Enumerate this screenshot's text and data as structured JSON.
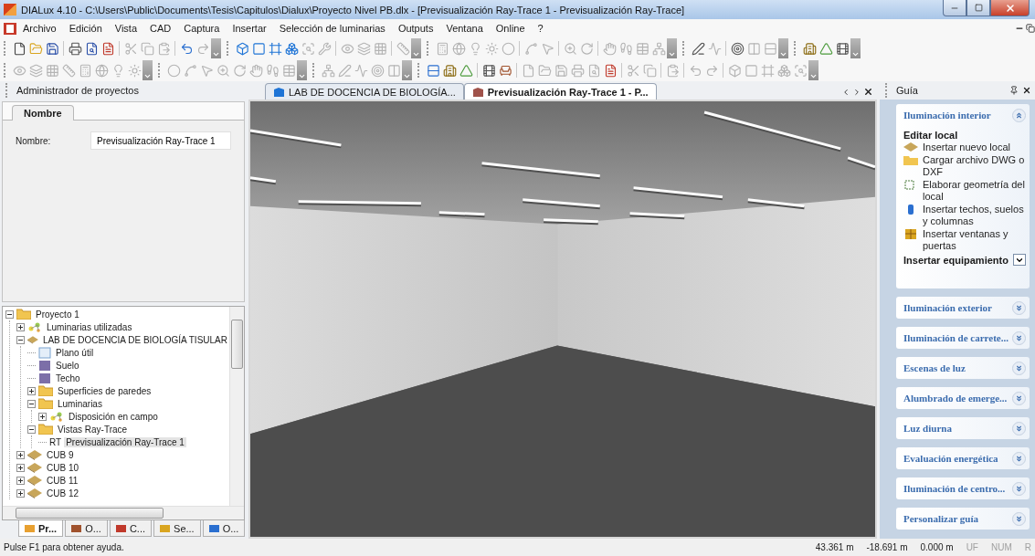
{
  "window": {
    "title": "DIALux 4.10 - C:\\Users\\Public\\Documents\\Tesis\\Capitulos\\Dialux\\Proyecto Nivel PB.dlx - [Previsualización Ray-Trace 1 - Previsualización Ray-Trace]"
  },
  "menu": [
    "Archivo",
    "Edición",
    "Vista",
    "CAD",
    "Captura",
    "Insertar",
    "Selección de luminarias",
    "Outputs",
    "Ventana",
    "Online",
    "?"
  ],
  "toolbars": [
    {
      "bars": [
        {
          "groups": [
            {
              "buttons": [
                {
                  "disabled": false
                },
                {
                  "disabled": false
                },
                {
                  "disabled": false
                }
              ]
            },
            {
              "buttons": [
                {
                  "disabled": false
                },
                {
                  "disabled": false
                },
                {
                  "disabled": false
                }
              ]
            },
            {
              "buttons": [
                {
                  "disabled": true
                },
                {
                  "disabled": true
                },
                {
                  "disabled": true
                }
              ]
            },
            {
              "buttons": [
                {
                  "disabled": false
                },
                {
                  "disabled": true
                }
              ]
            }
          ]
        },
        {
          "groups": [
            {
              "buttons": [
                {
                  "disabled": false
                },
                {
                  "disabled": false
                },
                {
                  "disabled": false
                },
                {
                  "disabled": false
                },
                {
                  "disabled": true
                },
                {
                  "disabled": true
                }
              ]
            },
            {
              "buttons": [
                {
                  "disabled": true
                },
                {
                  "disabled": true
                },
                {
                  "disabled": true
                }
              ]
            },
            {
              "buttons": [
                {
                  "disabled": true
                }
              ]
            }
          ]
        },
        {
          "groups": [
            {
              "buttons": [
                {
                  "disabled": true
                },
                {
                  "disabled": true
                },
                {
                  "disabled": true
                },
                {
                  "disabled": true
                },
                {
                  "disabled": true
                }
              ]
            },
            {
              "buttons": [
                {
                  "disabled": true
                },
                {
                  "disabled": true
                }
              ]
            },
            {
              "buttons": [
                {
                  "disabled": true
                },
                {
                  "disabled": true
                }
              ]
            },
            {
              "buttons": [
                {
                  "disabled": true
                },
                {
                  "disabled": true
                },
                {
                  "disabled": true
                },
                {
                  "disabled": true
                }
              ]
            }
          ]
        },
        {
          "groups": [
            {
              "buttons": [
                {
                  "disabled": false
                },
                {
                  "disabled": true
                }
              ]
            },
            {
              "buttons": [
                {
                  "disabled": false
                },
                {
                  "disabled": true
                },
                {
                  "disabled": true
                }
              ]
            }
          ]
        },
        {
          "groups": [
            {
              "buttons": [
                {
                  "disabled": false
                },
                {
                  "disabled": false
                },
                {
                  "disabled": false
                }
              ]
            }
          ]
        }
      ]
    },
    {
      "bars": [
        {
          "groups": [
            {
              "buttons": [
                {
                  "disabled": true
                },
                {
                  "disabled": true
                },
                {
                  "disabled": true
                },
                {
                  "disabled": true
                },
                {
                  "disabled": true
                },
                {
                  "disabled": true
                },
                {
                  "disabled": true
                },
                {
                  "disabled": true
                }
              ]
            }
          ]
        },
        {
          "groups": [
            {
              "buttons": [
                {
                  "disabled": true
                },
                {
                  "disabled": true
                },
                {
                  "disabled": true
                },
                {
                  "disabled": true
                },
                {
                  "disabled": true
                },
                {
                  "disabled": true
                },
                {
                  "disabled": true
                },
                {
                  "disabled": true
                }
              ]
            }
          ]
        },
        {
          "groups": [
            {
              "buttons": [
                {
                  "disabled": true
                },
                {
                  "disabled": true
                },
                {
                  "disabled": true
                },
                {
                  "disabled": true
                },
                {
                  "disabled": true
                }
              ]
            }
          ]
        },
        {
          "groups": [
            {
              "buttons": [
                {
                  "disabled": false
                },
                {
                  "disabled": false
                },
                {
                  "disabled": false
                }
              ]
            },
            {
              "buttons": [
                {
                  "disabled": false
                },
                {
                  "disabled": false
                }
              ]
            },
            {
              "buttons": [
                {
                  "disabled": true
                },
                {
                  "disabled": true
                },
                {
                  "disabled": true
                },
                {
                  "disabled": true
                },
                {
                  "disabled": true
                },
                {
                  "disabled": false
                }
              ]
            },
            {
              "buttons": [
                {
                  "disabled": true
                },
                {
                  "disabled": true
                }
              ]
            },
            {
              "buttons": [
                {
                  "disabled": true
                }
              ]
            },
            {
              "buttons": [
                {
                  "disabled": true
                },
                {
                  "disabled": true
                }
              ]
            },
            {
              "buttons": [
                {
                  "disabled": true
                },
                {
                  "disabled": true
                },
                {
                  "disabled": true
                },
                {
                  "disabled": true
                },
                {
                  "disabled": true
                }
              ]
            }
          ]
        }
      ]
    }
  ],
  "project_manager": {
    "title": "Administrador de proyectos",
    "properties": {
      "tabs": [
        {
          "label": "Nombre",
          "selected": true
        }
      ],
      "fields": [
        {
          "label": "Nombre:",
          "value": "Previsualización Ray-Trace 1"
        }
      ]
    },
    "tree": [
      {
        "label": "Proyecto 1",
        "kind": "folder",
        "expanded": true,
        "selected": false,
        "children": [
          {
            "label": "Luminarias utilizadas",
            "kind": "luminaires",
            "expanded": false,
            "selected": false
          },
          {
            "label": "LAB DE DOCENCIA DE BIOLOGÍA TISULAR",
            "kind": "room",
            "expanded": true,
            "selected": false,
            "children": [
              {
                "label": "Plano útil",
                "kind": "plane",
                "selected": false
              },
              {
                "label": "Suelo",
                "kind": "surface",
                "selected": false
              },
              {
                "label": "Techo",
                "kind": "surface",
                "selected": false
              },
              {
                "label": "Superficies de paredes",
                "kind": "folder",
                "expanded": false,
                "selected": false
              },
              {
                "label": "Luminarias",
                "kind": "folder",
                "expanded": true,
                "selected": false,
                "children": [
                  {
                    "label": "Disposición en campo",
                    "kind": "luminaires",
                    "expanded": false,
                    "selected": false
                  }
                ]
              },
              {
                "label": "Vistas Ray-Trace",
                "kind": "folder",
                "expanded": true,
                "selected": false,
                "children": [
                  {
                    "label": "Previsualización Ray-Trace 1",
                    "kind": "raytrace",
                    "badge": "RT",
                    "selected": true
                  }
                ]
              }
            ]
          },
          {
            "label": "CUB 9",
            "kind": "room",
            "expanded": false,
            "selected": false
          },
          {
            "label": "CUB 10",
            "kind": "room",
            "expanded": false,
            "selected": false
          },
          {
            "label": "CUB 11",
            "kind": "room",
            "expanded": false,
            "selected": false
          },
          {
            "label": "CUB 12",
            "kind": "room",
            "expanded": false,
            "selected": false
          }
        ]
      }
    ],
    "tabs": [
      {
        "label": "Pr...",
        "selected": true
      },
      {
        "label": "O...",
        "selected": false
      },
      {
        "label": "C...",
        "selected": false
      },
      {
        "label": "Se...",
        "selected": false
      },
      {
        "label": "O...",
        "selected": false
      }
    ]
  },
  "documents": {
    "tabs": [
      {
        "label": "LAB DE DOCENCIA DE BIOLOGÍA...",
        "selected": false
      },
      {
        "label": "Previsualización Ray-Trace 1 - P...",
        "selected": true
      }
    ]
  },
  "guide": {
    "title": "Guía",
    "sections": [
      {
        "title": "Iluminación interior",
        "expanded": true,
        "groups": [
          {
            "heading": "Editar local",
            "items": [
              "Insertar nuevo local",
              "Cargar archivo DWG o DXF",
              "Elaborar geometría del local",
              "Insertar techos, suelos y columnas",
              "Insertar ventanas y puertas"
            ]
          },
          {
            "heading": "Insertar equipamiento"
          }
        ]
      },
      {
        "title": "Iluminación exterior",
        "expanded": false
      },
      {
        "title": "Iluminación de carrete...",
        "expanded": false
      },
      {
        "title": "Escenas de luz",
        "expanded": false
      },
      {
        "title": "Alumbrado de emerge...",
        "expanded": false
      },
      {
        "title": "Luz diurna",
        "expanded": false
      },
      {
        "title": "Evaluación energética",
        "expanded": false
      },
      {
        "title": "Iluminación de centro...",
        "expanded": false
      },
      {
        "title": "Personalizar guía",
        "expanded": false
      }
    ]
  },
  "status_bar": {
    "message": "Pulse F1 para obtener ayuda.",
    "coordinates": [
      "43.361 m",
      "-18.691 m",
      "0.000 m"
    ],
    "indicators": [
      {
        "label": "UF",
        "on": false
      },
      {
        "label": "NUM",
        "on": false
      },
      {
        "label": "R",
        "on": false
      }
    ]
  }
}
